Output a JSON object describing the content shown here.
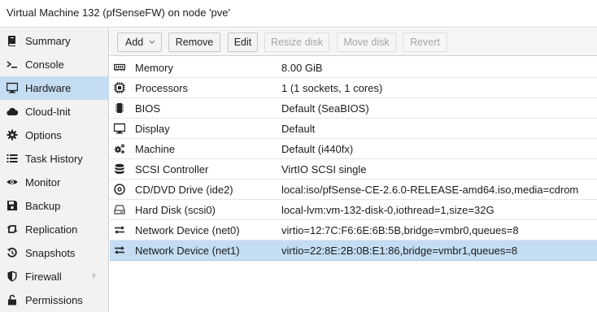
{
  "title": "Virtual Machine 132 (pfSenseFW) on node 'pve'",
  "sidebar": {
    "items": [
      {
        "label": "Summary",
        "icon": "book-icon"
      },
      {
        "label": "Console",
        "icon": "terminal-icon"
      },
      {
        "label": "Hardware",
        "icon": "desktop-icon",
        "active": true
      },
      {
        "label": "Cloud-Init",
        "icon": "cloud-icon"
      },
      {
        "label": "Options",
        "icon": "gear-icon"
      },
      {
        "label": "Task History",
        "icon": "list-icon"
      },
      {
        "label": "Monitor",
        "icon": "eye-icon"
      },
      {
        "label": "Backup",
        "icon": "floppy-icon"
      },
      {
        "label": "Replication",
        "icon": "retweet-icon"
      },
      {
        "label": "Snapshots",
        "icon": "history-icon"
      },
      {
        "label": "Firewall",
        "icon": "shield-icon",
        "has_submenu": true
      },
      {
        "label": "Permissions",
        "icon": "unlock-icon"
      }
    ]
  },
  "toolbar": {
    "add": "Add",
    "remove": "Remove",
    "edit": "Edit",
    "resize": "Resize disk",
    "move": "Move disk",
    "revert": "Revert"
  },
  "hardware": [
    {
      "name": "Memory",
      "value": "8.00 GiB",
      "icon": "memory-icon"
    },
    {
      "name": "Processors",
      "value": "1 (1 sockets, 1 cores)",
      "icon": "cpu-icon"
    },
    {
      "name": "BIOS",
      "value": "Default (SeaBIOS)",
      "icon": "microchip-icon"
    },
    {
      "name": "Display",
      "value": "Default",
      "icon": "monitor-icon"
    },
    {
      "name": "Machine",
      "value": "Default (i440fx)",
      "icon": "cogs-icon"
    },
    {
      "name": "SCSI Controller",
      "value": "VirtIO SCSI single",
      "icon": "database-icon"
    },
    {
      "name": "CD/DVD Drive (ide2)",
      "value": "local:iso/pfSense-CE-2.6.0-RELEASE-amd64.iso,media=cdrom",
      "icon": "cdrom-icon"
    },
    {
      "name": "Hard Disk (scsi0)",
      "value": "local-lvm:vm-132-disk-0,iothread=1,size=32G",
      "icon": "hdd-icon"
    },
    {
      "name": "Network Device (net0)",
      "value": "virtio=12:7C:F6:6E:6B:5B,bridge=vmbr0,queues=8",
      "icon": "exchange-icon"
    },
    {
      "name": "Network Device (net1)",
      "value": "virtio=22:8E:2B:0B:E1:86,bridge=vmbr1,queues=8",
      "icon": "exchange-icon",
      "selected": true
    }
  ]
}
